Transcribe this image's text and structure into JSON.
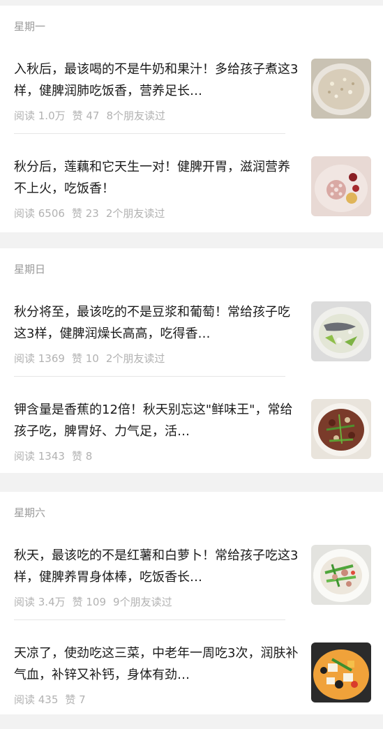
{
  "groups": [
    {
      "day": "星期一",
      "articles": [
        {
          "title": "入秋后，最该喝的不是牛奶和果汁！多给孩子煮这3样，健脾润肺吃饭香，营养足长…",
          "reads": "阅读 1.0万",
          "likes": "赞 47",
          "friends": "8个朋友读过",
          "thumb_icon": "porridge-bowl-thumbnail"
        },
        {
          "title": "秋分后，莲藕和它天生一对！健脾开胃，滋润营养不上火，吃饭香！",
          "reads": "阅读 6506",
          "likes": "赞 23",
          "friends": "2个朋友读过",
          "thumb_icon": "lotus-root-soup-thumbnail"
        }
      ]
    },
    {
      "day": "星期日",
      "articles": [
        {
          "title": "秋分将至，最该吃的不是豆浆和葡萄！常给孩子吃这3样，健脾润燥长高高，吃得香…",
          "reads": "阅读 1369",
          "likes": "赞 10",
          "friends": "2个朋友读过",
          "thumb_icon": "fish-soup-thumbnail"
        },
        {
          "title": "钾含量是香蕉的12倍！秋天别忘这\"鲜味王\"，常给孩子吃，脾胃好、力气足，活…",
          "reads": "阅读 1343",
          "likes": "赞 8",
          "friends": "",
          "thumb_icon": "stir-fry-thumbnail"
        }
      ]
    },
    {
      "day": "星期六",
      "articles": [
        {
          "title": "秋天，最该吃的不是红薯和白萝卜！常给孩子吃这3样，健脾养胃身体棒，吃饭香长…",
          "reads": "阅读 3.4万",
          "likes": "赞 109",
          "friends": "9个朋友读过",
          "thumb_icon": "pork-celery-stir-fry-thumbnail"
        },
        {
          "title": "天凉了，使劲吃这三菜，中老年一周吃3次，润肤补气血，补锌又补钙，身体有劲…",
          "reads": "阅读 435",
          "likes": "赞 7",
          "friends": "",
          "thumb_icon": "tofu-vegetable-thumbnail"
        }
      ]
    }
  ]
}
